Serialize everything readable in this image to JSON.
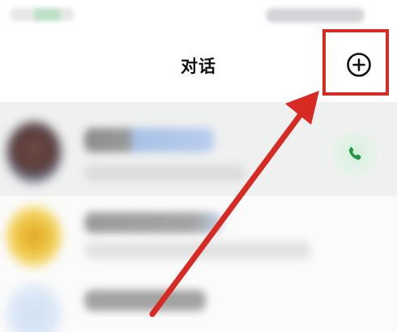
{
  "header": {
    "title": "对话"
  },
  "icons": {
    "add": "plus-circle-icon",
    "call": "phone-icon"
  },
  "colors": {
    "annotation": "#d62a22",
    "call_green": "#1e9a46",
    "selected_row": "#eff0f0"
  }
}
